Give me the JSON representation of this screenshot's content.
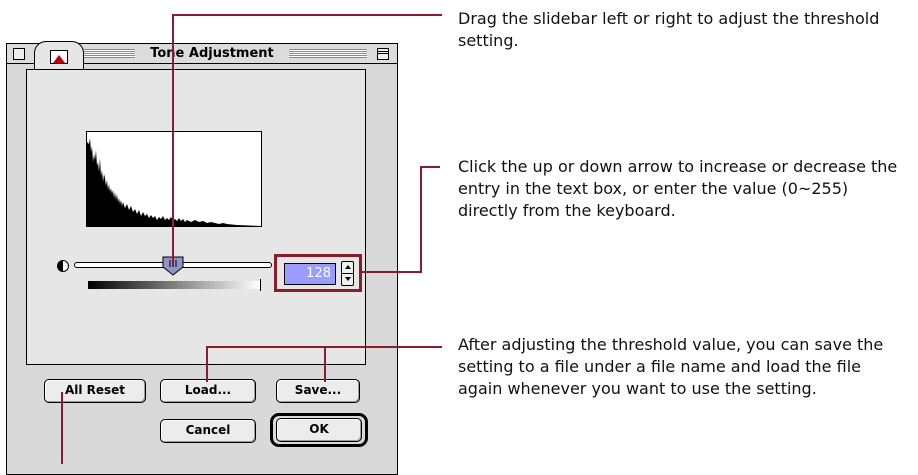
{
  "dialog": {
    "title": "Tone Adjustment",
    "active_tab_icon": "histogram-tab-icon",
    "threshold_value": "128",
    "threshold_range": [
      0,
      255
    ],
    "slider_position_value": 128,
    "buttons": {
      "all_reset": "All Reset",
      "load": "Load...",
      "save": "Save...",
      "cancel": "Cancel",
      "ok": "OK"
    }
  },
  "callouts": {
    "slidebar": "Drag the slidebar left or right to adjust the threshold setting.",
    "stepper": "Click the up or down arrow to increase or decrease the entry in the text box, or enter the value (0~255) directly from the keyboard.",
    "load_save": "After adjusting the threshold value, you can save the setting to a file under a file name and load the file again whenever you want to use the setting."
  },
  "colors": {
    "callout_line": "#8a1c2e",
    "value_field_bg": "#9a9cff",
    "window_bg": "#d9d9d9"
  }
}
